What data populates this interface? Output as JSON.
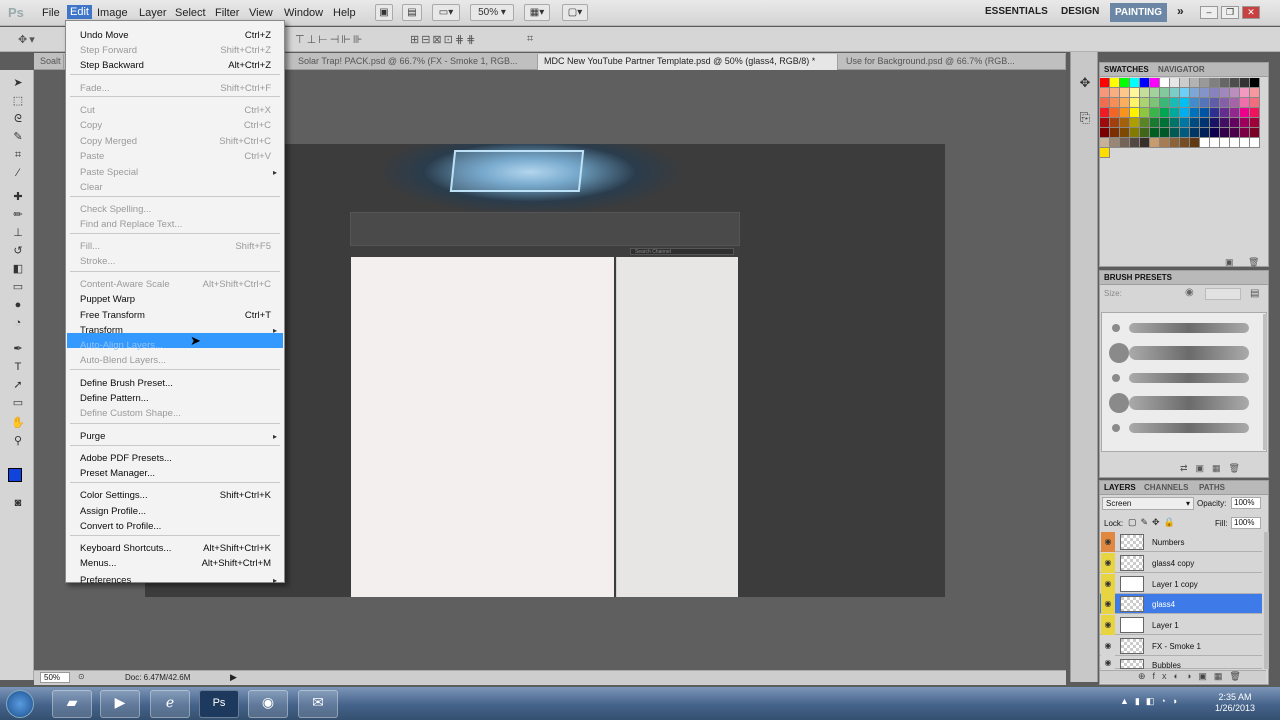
{
  "app": {
    "logo": "Ps"
  },
  "menubar": {
    "items": [
      "File",
      "Edit",
      "Image",
      "Layer",
      "Select",
      "Filter",
      "View",
      "Window",
      "Help"
    ],
    "zoom": "50%",
    "workspaces": [
      "ESSENTIALS",
      "DESIGN",
      "PAINTING"
    ]
  },
  "tabs": [
    "Soalt",
    "Solar Trap! PACK.psd @ 66.7% (FX - Smoke 1, RGB...",
    "MDC New YouTube Partner Template.psd @ 50% (glass4, RGB/8) *",
    "Use for Background.psd @ 66.7% (RGB..."
  ],
  "edit_menu": [
    {
      "label": "Undo Move",
      "shortcut": "Ctrl+Z",
      "disabled": false
    },
    {
      "label": "Step Forward",
      "shortcut": "Shift+Ctrl+Z",
      "disabled": true
    },
    {
      "label": "Step Backward",
      "shortcut": "Alt+Ctrl+Z",
      "disabled": false
    },
    {
      "label": "Fade...",
      "shortcut": "Shift+Ctrl+F",
      "disabled": true
    },
    {
      "label": "Cut",
      "shortcut": "Ctrl+X",
      "disabled": true
    },
    {
      "label": "Copy",
      "shortcut": "Ctrl+C",
      "disabled": true
    },
    {
      "label": "Copy Merged",
      "shortcut": "Shift+Ctrl+C",
      "disabled": true
    },
    {
      "label": "Paste",
      "shortcut": "Ctrl+V",
      "disabled": true
    },
    {
      "label": "Paste Special",
      "shortcut": "",
      "disabled": true
    },
    {
      "label": "Clear",
      "shortcut": "",
      "disabled": true
    },
    {
      "label": "Check Spelling...",
      "shortcut": "",
      "disabled": true
    },
    {
      "label": "Find and Replace Text...",
      "shortcut": "",
      "disabled": true
    },
    {
      "label": "Fill...",
      "shortcut": "Shift+F5",
      "disabled": true
    },
    {
      "label": "Stroke...",
      "shortcut": "",
      "disabled": true
    },
    {
      "label": "Content-Aware Scale",
      "shortcut": "Alt+Shift+Ctrl+C",
      "disabled": true
    },
    {
      "label": "Puppet Warp",
      "shortcut": "",
      "disabled": false
    },
    {
      "label": "Free Transform",
      "shortcut": "Ctrl+T",
      "disabled": false
    },
    {
      "label": "Transform",
      "shortcut": "",
      "disabled": false
    },
    {
      "label": "Auto-Align Layers...",
      "shortcut": "",
      "disabled": true
    },
    {
      "label": "Auto-Blend Layers...",
      "shortcut": "",
      "disabled": true
    },
    {
      "label": "Define Brush Preset...",
      "shortcut": "",
      "disabled": false
    },
    {
      "label": "Define Pattern...",
      "shortcut": "",
      "disabled": false
    },
    {
      "label": "Define Custom Shape...",
      "shortcut": "",
      "disabled": true
    },
    {
      "label": "Purge",
      "shortcut": "",
      "disabled": false
    },
    {
      "label": "Adobe PDF Presets...",
      "shortcut": "",
      "disabled": false
    },
    {
      "label": "Preset Manager...",
      "shortcut": "",
      "disabled": false
    },
    {
      "label": "Color Settings...",
      "shortcut": "Shift+Ctrl+K",
      "disabled": false
    },
    {
      "label": "Assign Profile...",
      "shortcut": "",
      "disabled": false
    },
    {
      "label": "Convert to Profile...",
      "shortcut": "",
      "disabled": false
    },
    {
      "label": "Keyboard Shortcuts...",
      "shortcut": "Alt+Shift+Ctrl+K",
      "disabled": false
    },
    {
      "label": "Menus...",
      "shortcut": "Alt+Shift+Ctrl+M",
      "disabled": false
    },
    {
      "label": "Preferences",
      "shortcut": "",
      "disabled": false
    }
  ],
  "canvas": {
    "search_placeholder": "Search Channel"
  },
  "status": {
    "zoom": "50%",
    "doc": "Doc: 6.47M/42.6M"
  },
  "panels": {
    "swatches_tabs": [
      "SWATCHES",
      "NAVIGATOR"
    ],
    "brush_tab": "BRUSH PRESETS",
    "brush_size_label": "Size:",
    "layers_tabs": [
      "LAYERS",
      "CHANNELS",
      "PATHS"
    ],
    "blend_mode": "Screen",
    "opacity_label": "Opacity:",
    "opacity_value": "100%",
    "lock_label": "Lock:",
    "fill_label": "Fill:",
    "fill_value": "100%"
  },
  "layers": [
    "Numbers",
    "glass4 copy",
    "Layer 1 copy",
    "glass4",
    "Layer 1",
    "FX - Smoke 1",
    "Bubbles"
  ],
  "selected_layer": "glass4",
  "taskbar": {
    "time": "2:35 AM",
    "date": "1/26/2013"
  },
  "colors": {
    "menu_highlight": "#3399ff",
    "layer_selected": "#3e7be8",
    "eye_bg": "#e8d340",
    "foreground": "#1144dd"
  }
}
